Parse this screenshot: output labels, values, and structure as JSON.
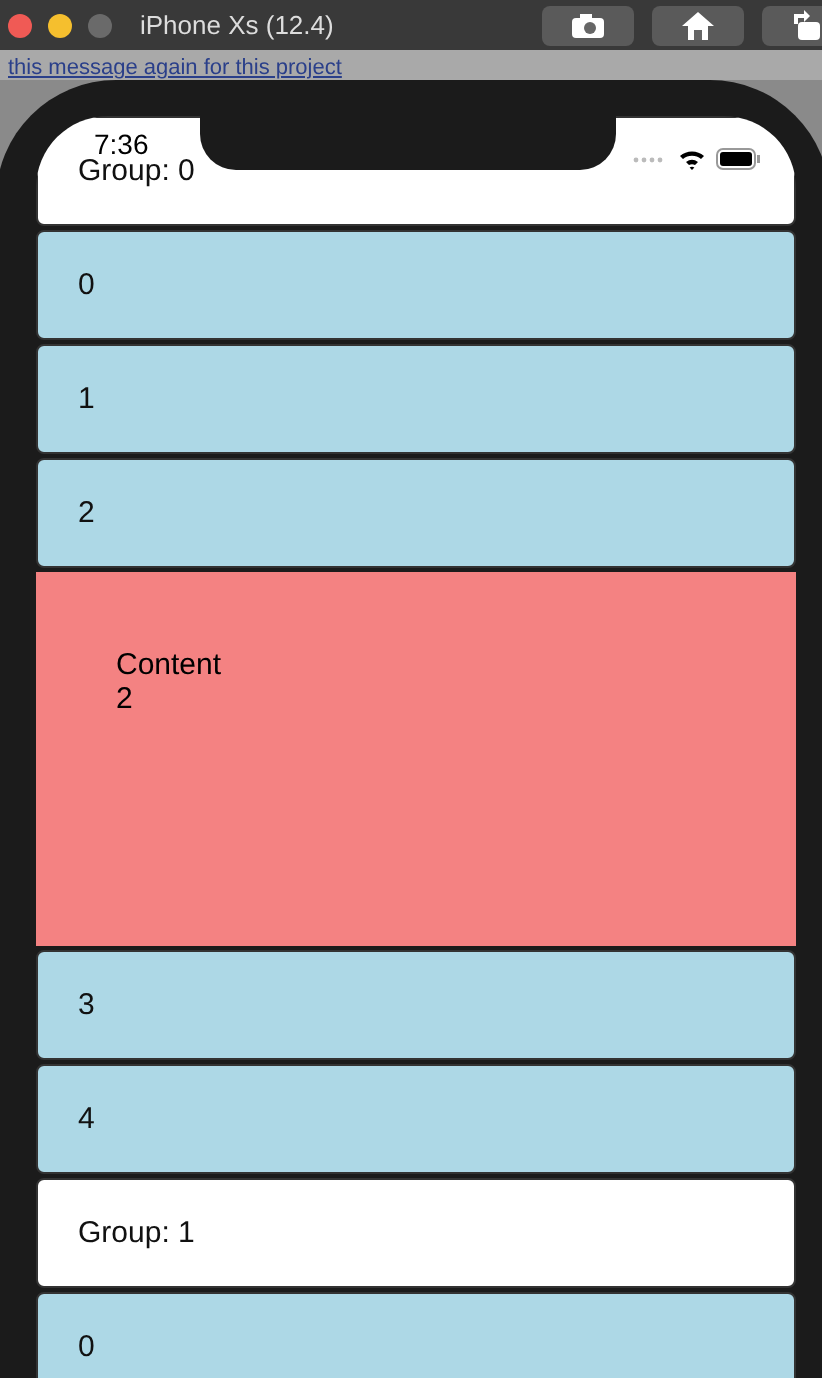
{
  "window": {
    "title": "iPhone Xs (12.4)"
  },
  "toolbar_buttons": [
    {
      "kind": "screenshot"
    },
    {
      "kind": "home"
    },
    {
      "kind": "rotate"
    }
  ],
  "banner": {
    "link": "this message again for this project"
  },
  "status_bar": {
    "time": "7:36"
  },
  "list": [
    {
      "kind": "header",
      "text": "Group: 0"
    },
    {
      "kind": "row",
      "text": "0"
    },
    {
      "kind": "row",
      "text": "1"
    },
    {
      "kind": "row",
      "text": "2"
    },
    {
      "kind": "content",
      "text": "Content\n2"
    },
    {
      "kind": "row",
      "text": "3"
    },
    {
      "kind": "row",
      "text": "4"
    },
    {
      "kind": "header",
      "text": "Group: 1"
    },
    {
      "kind": "row",
      "text": "0"
    }
  ]
}
